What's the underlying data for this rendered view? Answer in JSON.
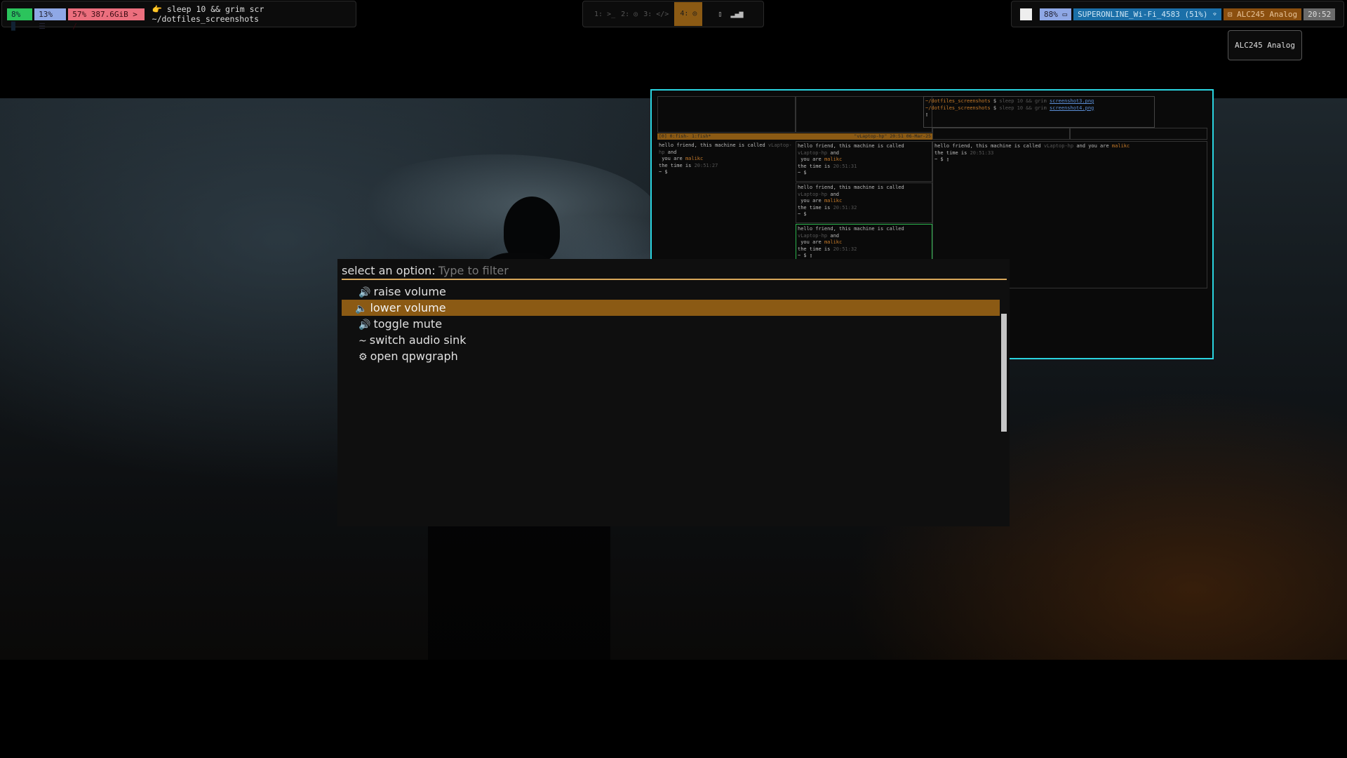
{
  "waybar_left": {
    "cpu": "8% ▉",
    "mem": "13% ☰",
    "disk": "57% 387.6GiB > /",
    "command": "👉 sleep 10 && grim scr ~/dotfiles_screenshots"
  },
  "workspaces": [
    {
      "label": "1: >_"
    },
    {
      "label": "2: ◎"
    },
    {
      "label": "3: </>"
    },
    {
      "label": "4: ◎",
      "active": true
    }
  ],
  "tray": {
    "phone": "▯",
    "signal": "▂▄▆"
  },
  "waybar_right": {
    "battery": "88% ▭",
    "wifi": "SUPERONLINE_Wi-Fi_4583 (51%) ⌔",
    "audio": "⊡ ALC245 Analog",
    "time": "20:52"
  },
  "tooltip": "ALC245 Analog",
  "terminal": {
    "top_right_lines": [
      {
        "dir": "~/dotfiles_screenshots",
        "cmd": "sleep 10 && grim",
        "file": "screenshot3.png"
      },
      {
        "dir": "~/dotfiles_screenshots",
        "cmd": "sleep 10 && grim",
        "file": "screenshot4.png"
      }
    ],
    "status_left": "[0] 0:fish- 1:fish*",
    "status_right": "\"vLaptop-hp\" 20:51 06-Mar-25",
    "greeting": "hello friend, this machine is called",
    "host": "vLaptop-hp",
    "and": "and",
    "you_are": "you are",
    "user": "malikc",
    "time_is": "the time is",
    "times": [
      "20:51:27",
      "20:51:31",
      "20:51:32",
      "20:51:32",
      "20:51:33"
    ],
    "prompt": "~ $"
  },
  "launcher": {
    "prompt": "select an option:",
    "placeholder": "Type to filter",
    "items": [
      {
        "icon": "🔊",
        "label": "raise volume"
      },
      {
        "icon": "🔈",
        "label": "lower volume",
        "selected": true
      },
      {
        "icon": "🔊",
        "label": "toggle mute"
      },
      {
        "icon": "~",
        "label": "switch audio sink"
      },
      {
        "icon": "⚙",
        "label": "open qpwgraph"
      }
    ]
  },
  "colors": {
    "accent": "#8b5a14",
    "border_active": "#2ad4e0",
    "prompt_underline": "#d9a85a"
  }
}
